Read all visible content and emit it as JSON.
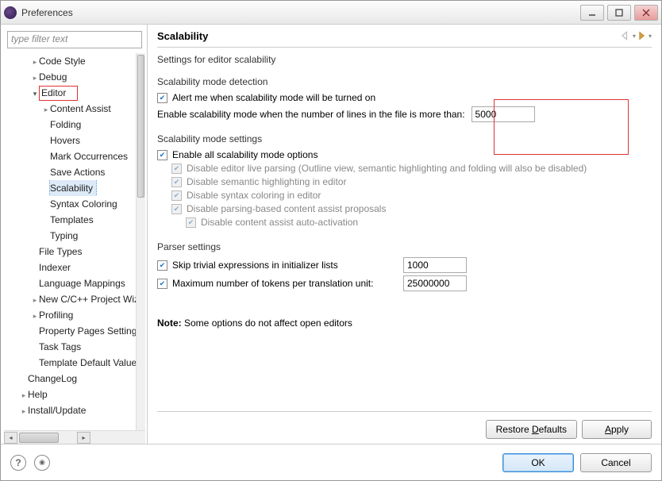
{
  "window": {
    "title": "Preferences"
  },
  "sidebar": {
    "filter_placeholder": "type filter text",
    "items": [
      {
        "label": "Code Style",
        "indent": 2,
        "arrow": "collapsed"
      },
      {
        "label": "Debug",
        "indent": 2,
        "arrow": "collapsed"
      },
      {
        "label": "Editor",
        "indent": 2,
        "arrow": "expanded",
        "highlight": true
      },
      {
        "label": "Content Assist",
        "indent": 3,
        "arrow": "collapsed"
      },
      {
        "label": "Folding",
        "indent": 3
      },
      {
        "label": "Hovers",
        "indent": 3
      },
      {
        "label": "Mark Occurrences",
        "indent": 3
      },
      {
        "label": "Save Actions",
        "indent": 3
      },
      {
        "label": "Scalability",
        "indent": 3,
        "selected": true
      },
      {
        "label": "Syntax Coloring",
        "indent": 3
      },
      {
        "label": "Templates",
        "indent": 3
      },
      {
        "label": "Typing",
        "indent": 3
      },
      {
        "label": "File Types",
        "indent": 2
      },
      {
        "label": "Indexer",
        "indent": 2
      },
      {
        "label": "Language Mappings",
        "indent": 2
      },
      {
        "label": "New C/C++ Project Wizard",
        "indent": 2,
        "arrow": "collapsed"
      },
      {
        "label": "Profiling",
        "indent": 2,
        "arrow": "collapsed"
      },
      {
        "label": "Property Pages Settings",
        "indent": 2
      },
      {
        "label": "Task Tags",
        "indent": 2
      },
      {
        "label": "Template Default Values",
        "indent": 2
      },
      {
        "label": "ChangeLog",
        "indent": 1
      },
      {
        "label": "Help",
        "indent": 1,
        "arrow": "collapsed"
      },
      {
        "label": "Install/Update",
        "indent": 1,
        "arrow": "collapsed"
      }
    ]
  },
  "content": {
    "title": "Scalability",
    "subtitle": "Settings for editor scalability",
    "group_detect": {
      "title": "Scalability mode detection",
      "alert_label": "Alert me when scalability mode will be turned on",
      "alert_checked": true,
      "threshold_label": "Enable scalability mode when the number of lines in the file is more than:",
      "threshold_value": "5000"
    },
    "group_settings": {
      "title": "Scalability mode settings",
      "enable_all_label": "Enable all scalability mode options",
      "enable_all_checked": true,
      "opt1": "Disable editor live parsing (Outline view, semantic highlighting and folding will also be disabled)",
      "opt2": "Disable semantic highlighting in editor",
      "opt3": "Disable syntax coloring in editor",
      "opt4": "Disable parsing-based content assist proposals",
      "opt5": "Disable content assist auto-activation"
    },
    "group_parser": {
      "title": "Parser settings",
      "row1_label": "Skip trivial expressions in initializer lists",
      "row1_checked": true,
      "row1_value": "1000",
      "row2_label": "Maximum number of tokens per translation unit:",
      "row2_checked": true,
      "row2_value": "25000000"
    },
    "note_label": "Note:",
    "note_text": " Some options do not affect open editors",
    "restore_label": "Restore Defaults",
    "apply_label": "Apply"
  },
  "footer": {
    "ok_label": "OK",
    "cancel_label": "Cancel"
  }
}
